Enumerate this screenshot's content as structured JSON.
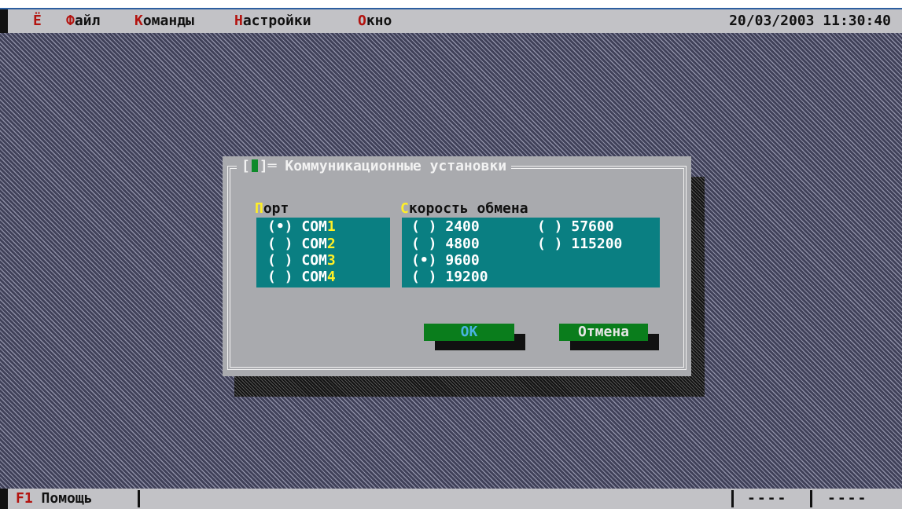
{
  "menubar": {
    "system_hotkey": "Ё",
    "items": [
      {
        "hotkey": "Ф",
        "rest": "айл"
      },
      {
        "hotkey": "К",
        "rest": "оманды"
      },
      {
        "hotkey": "Н",
        "rest": "астройки"
      },
      {
        "hotkey": "О",
        "rest": "кно"
      }
    ],
    "clock": "20/03/2003 11:30:40"
  },
  "dialog": {
    "title": "Коммуникационные установки",
    "port_group": {
      "label_hotkey": "П",
      "label_rest": "орт",
      "options": [
        {
          "mark": "(•)",
          "prefix": "COM",
          "hotkey": "1"
        },
        {
          "mark": "( )",
          "prefix": "COM",
          "hotkey": "2"
        },
        {
          "mark": "( )",
          "prefix": "COM",
          "hotkey": "3"
        },
        {
          "mark": "( )",
          "prefix": "COM",
          "hotkey": "4"
        }
      ],
      "selected": "COM1"
    },
    "speed_group": {
      "label_hotkey": "С",
      "label_rest": "корость обмена",
      "options": [
        {
          "mark": "( )",
          "value": "2400"
        },
        {
          "mark": "( )",
          "value": "4800"
        },
        {
          "mark": "(•)",
          "value": "9600"
        },
        {
          "mark": "( )",
          "value": "19200"
        },
        {
          "mark": "( )",
          "value": "57600"
        },
        {
          "mark": "( )",
          "value": "115200"
        }
      ],
      "selected": "9600"
    },
    "buttons": {
      "ok": "OK",
      "cancel": "Отмена"
    }
  },
  "statusbar": {
    "help_key": "F1",
    "help_label": "Помощь",
    "indicator1": "----",
    "indicator2": "----"
  },
  "colors": {
    "hotkey_red": "#b3130f",
    "hotkey_yellow": "#ffef26",
    "list_teal": "#0a7f82",
    "button_green": "#0a7d1c",
    "dialog_gray": "#a9aaae"
  }
}
